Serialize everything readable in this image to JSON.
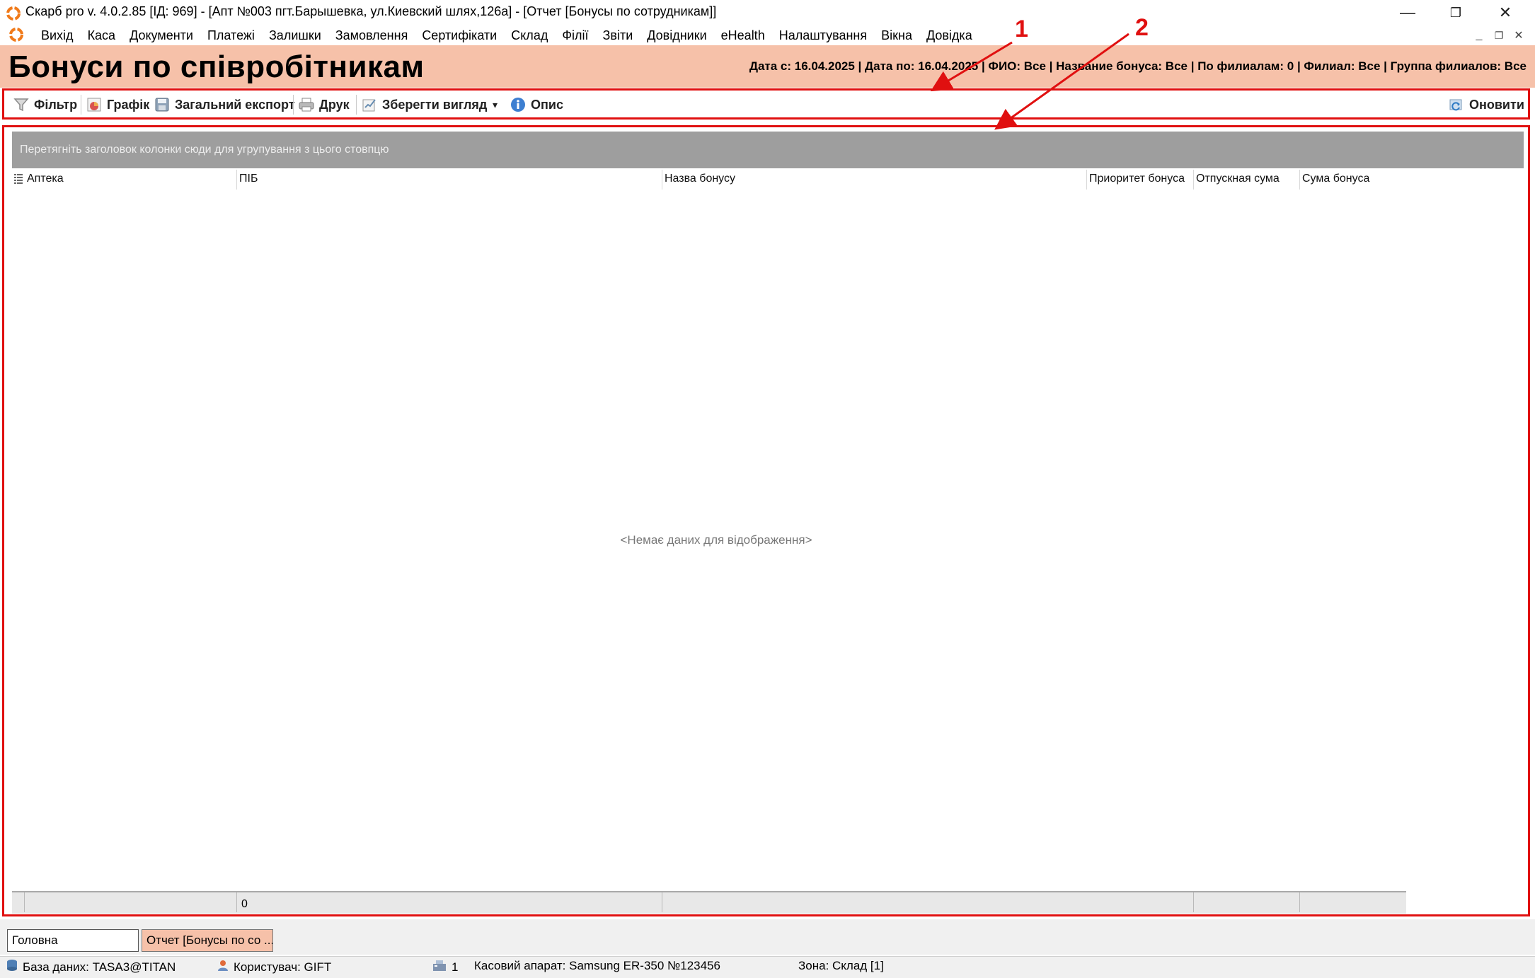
{
  "window": {
    "title": "Скарб pro v. 4.0.2.85 [ІД: 969] - [Апт №003 пгт.Барышевка, ул.Киевский шлях,126а] - [Отчет [Бонусы по сотрудникам]]",
    "minimize": "—",
    "restore": "❐",
    "close": "✕"
  },
  "menu": {
    "items": [
      "Вихід",
      "Каса",
      "Документи",
      "Платежі",
      "Залишки",
      "Замовлення",
      "Сертифікати",
      "Склад",
      "Філії",
      "Звіти",
      "Довідники",
      "eHealth",
      "Налаштування",
      "Вікна",
      "Довідка"
    ],
    "mdi_minimize": "_",
    "mdi_restore": "❐",
    "mdi_close": "✕"
  },
  "header": {
    "title": "Бонуси по співробітникам",
    "filter_summary": "Дата с: 16.04.2025 | Дата по: 16.04.2025 | ФИО: Все | Название бонуса: Все | По филиалам: 0 | Филиал: Все | Группа филиалов: Все"
  },
  "toolbar": {
    "filter": "Фільтр",
    "chart": "Графік",
    "export": "Загальний експорт",
    "print": "Друк",
    "save_view": "Зберегти вигляд",
    "dropdown": "▾",
    "description": "Опис",
    "refresh": "Оновити"
  },
  "grid": {
    "group_hint": "Перетягніть заголовок колонки сюди для угрупування з цього стовпцю",
    "columns": [
      "Аптека",
      "ПІБ",
      "Назва бонусу",
      "Приоритет бонуса",
      "Отпускная сума",
      "Сума бонуса"
    ],
    "empty_text": "<Немає даних для відображення>",
    "footer_count": "0"
  },
  "window_tabs": {
    "main": "Головна",
    "report": "Отчет [Бонусы по со ..."
  },
  "status": {
    "database": "База даних: TASA3@TITAN",
    "user": "Користувач: GIFT",
    "kiosk_count": "1",
    "register": "Касовий апарат: Samsung ER-350 №123456",
    "zone": "Зона: Склад [1]"
  },
  "annotations": {
    "label_1": "1",
    "label_2": "2"
  },
  "colors": {
    "header_bg": "#f6c1a9",
    "highlight_frame": "#e01010",
    "group_panel": "#9e9e9e"
  }
}
